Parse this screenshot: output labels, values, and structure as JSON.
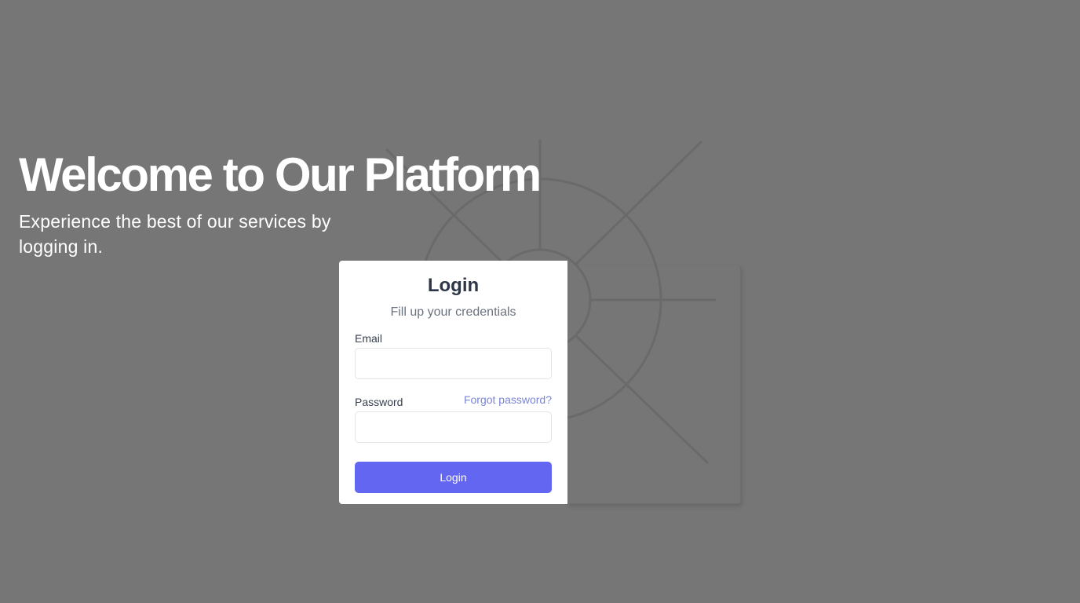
{
  "hero": {
    "title": "Welcome to Our Platform",
    "subtitle": "Experience the best of our services by logging in."
  },
  "login_card": {
    "title": "Login",
    "subtitle": "Fill up your credentials",
    "email_label": "Email",
    "email_value": "",
    "password_label": "Password",
    "password_value": "",
    "forgot_password": "Forgot password?",
    "login_button": "Login"
  },
  "colors": {
    "background": "#767676",
    "accent": "#6366f1",
    "link": "#7c86d6",
    "card": "#ffffff"
  },
  "icons": {
    "background_graphic": "compass-wheel-decoration"
  }
}
